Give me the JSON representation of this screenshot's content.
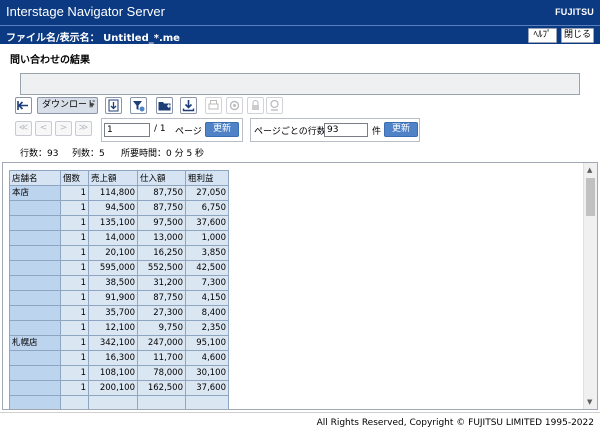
{
  "app": {
    "title": "Interstage Navigator Server",
    "logo": "FUJITSU"
  },
  "file": {
    "label": "ファイル名/表示名： Untitled_*.me"
  },
  "header_buttons": {
    "help": "ﾍﾙﾌﾟ",
    "close": "閉じる"
  },
  "section_title": "問い合わせの結果",
  "toolbar": {
    "download_label": "ダウンロード",
    "download_arrow": "▾"
  },
  "icons": [
    "back-arrow-icon",
    "export-icon",
    "filter-icon",
    "folder-add-icon",
    "download-icon",
    "print-icon",
    "settings-icon",
    "lock-icon",
    "config-icon"
  ],
  "paging": {
    "first": "≪",
    "prev": "<",
    "next": ">",
    "last": "≫",
    "page_value": "1",
    "page_total": "/ 1",
    "page_word": "ページ",
    "update": "更新",
    "rows_label": "ページごとの行数",
    "rows_value": "93",
    "rows_unit": "件",
    "rows_update": "更新"
  },
  "stats": {
    "rows": "行数：93",
    "cols": "列数：5",
    "time": "所要時間：0 分 5 秒"
  },
  "table": {
    "headers": [
      "店舗名",
      "個数",
      "売上額",
      "仕入額",
      "粗利益"
    ],
    "rows": [
      [
        "本店",
        "1",
        "114,800",
        "87,750",
        "27,050"
      ],
      [
        "",
        "1",
        "94,500",
        "87,750",
        "6,750"
      ],
      [
        "",
        "1",
        "135,100",
        "97,500",
        "37,600"
      ],
      [
        "",
        "1",
        "14,000",
        "13,000",
        "1,000"
      ],
      [
        "",
        "1",
        "20,100",
        "16,250",
        "3,850"
      ],
      [
        "",
        "1",
        "595,000",
        "552,500",
        "42,500"
      ],
      [
        "",
        "1",
        "38,500",
        "31,200",
        "7,300"
      ],
      [
        "",
        "1",
        "91,900",
        "87,750",
        "4,150"
      ],
      [
        "",
        "1",
        "35,700",
        "27,300",
        "8,400"
      ],
      [
        "",
        "1",
        "12,100",
        "9,750",
        "2,350"
      ],
      [
        "札幌店",
        "1",
        "342,100",
        "247,000",
        "95,100"
      ],
      [
        "",
        "1",
        "16,300",
        "11,700",
        "4,600"
      ],
      [
        "",
        "1",
        "108,100",
        "78,000",
        "30,100"
      ],
      [
        "",
        "1",
        "200,100",
        "162,500",
        "37,600"
      ],
      [
        "",
        "",
        "",
        "",
        ""
      ]
    ]
  },
  "footer": {
    "copyright": "All Rights Reserved, Copyright © FUJITSU LIMITED 1995-2022"
  }
}
